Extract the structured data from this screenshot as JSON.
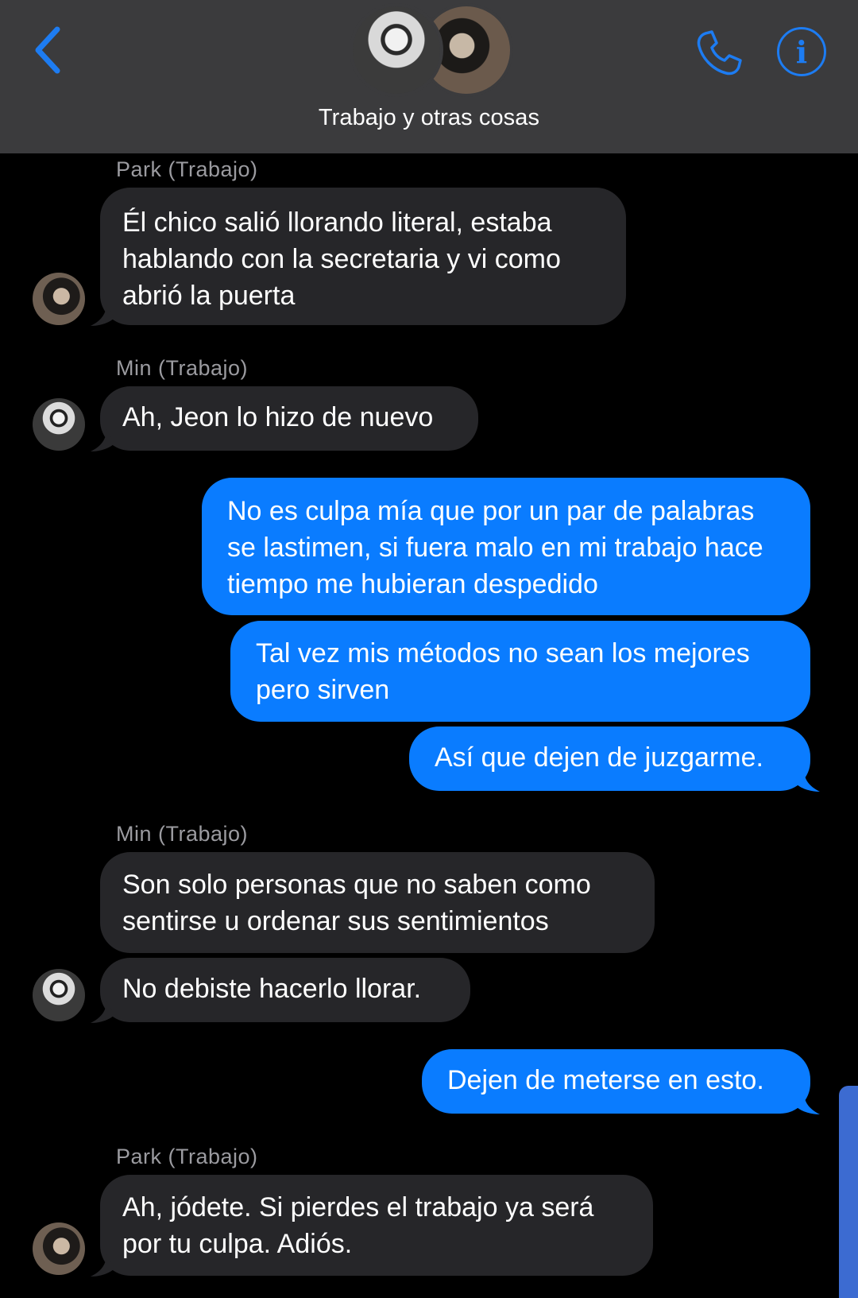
{
  "header": {
    "title": "Trabajo y otras cosas",
    "back_icon": "chevron-left-icon",
    "call_icon": "phone-icon",
    "info_icon": "info-icon",
    "info_glyph": "i",
    "accent_color": "#1d7cf2"
  },
  "messages": [
    {
      "sender": "Park (Trabajo)",
      "direction": "incoming",
      "text": "Él chico salió llorando literal, estaba hablando con la secretaria y vi como abrió la puerta"
    },
    {
      "sender": "Min (Trabajo)",
      "direction": "incoming",
      "text": "Ah, Jeon lo hizo de nuevo"
    },
    {
      "direction": "outgoing",
      "text": "No es culpa mía que por un par de palabras se lastimen, si fuera malo en mi trabajo hace tiempo me hubieran despedido"
    },
    {
      "direction": "outgoing",
      "text": "Tal vez mis métodos no sean los mejores pero sirven"
    },
    {
      "direction": "outgoing",
      "text": "Así que dejen de juzgarme."
    },
    {
      "sender": "Min (Trabajo)",
      "direction": "incoming",
      "text": "Son solo personas que no saben como sentirse u ordenar sus sentimientos"
    },
    {
      "direction": "incoming",
      "text": "No debiste hacerlo llorar."
    },
    {
      "direction": "outgoing",
      "text": "Dejen de meterse en esto."
    },
    {
      "sender": "Park (Trabajo)",
      "direction": "incoming",
      "text": "Ah, jódete. Si pierdes el trabajo ya será por tu culpa. Adiós."
    }
  ],
  "colors": {
    "incoming_bubble": "#262629",
    "outgoing_bubble": "#0a7cff",
    "header_bg": "#3b3b3d"
  }
}
